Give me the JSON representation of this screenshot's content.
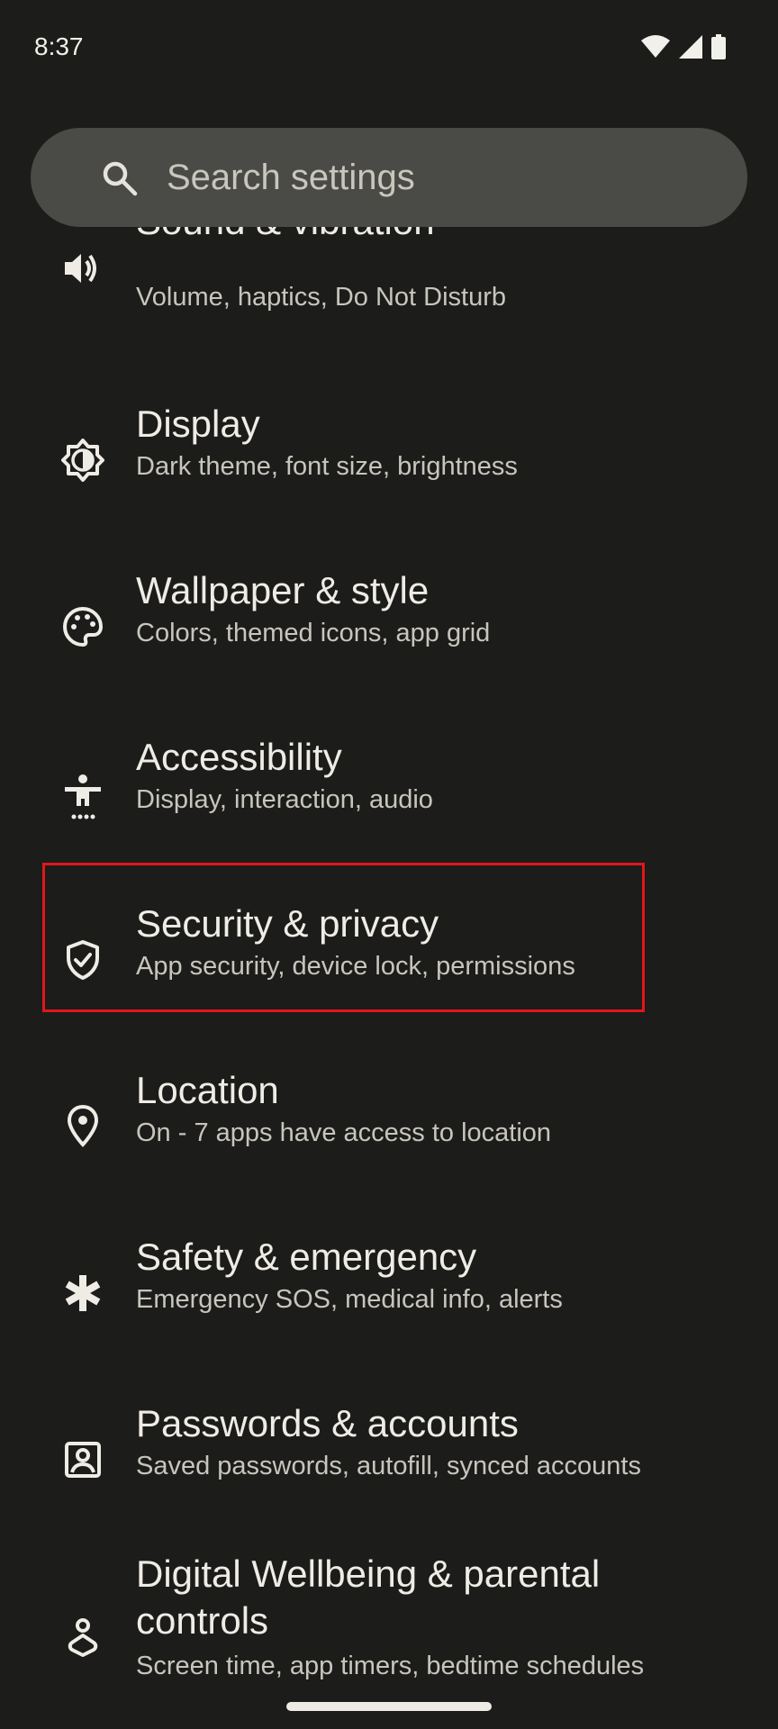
{
  "status_bar": {
    "time": "8:37",
    "icons": [
      "wifi-icon",
      "cell-signal-icon",
      "battery-icon"
    ]
  },
  "search": {
    "placeholder": "Search settings",
    "icon": "search-icon"
  },
  "settings": {
    "items": [
      {
        "title": "Sound & vibration",
        "subtitle": "Volume, haptics, Do Not Disturb",
        "icon": "volume-icon"
      },
      {
        "title": "Display",
        "subtitle": "Dark theme, font size, brightness",
        "icon": "brightness-icon"
      },
      {
        "title": "Wallpaper & style",
        "subtitle": "Colors, themed icons, app grid",
        "icon": "palette-icon"
      },
      {
        "title": "Accessibility",
        "subtitle": "Display, interaction, audio",
        "icon": "accessibility-icon"
      },
      {
        "title": "Security & privacy",
        "subtitle": "App security, device lock, permissions",
        "icon": "shield-icon"
      },
      {
        "title": "Location",
        "subtitle": "On - 7 apps have access to location",
        "icon": "location-pin-icon"
      },
      {
        "title": "Safety & emergency",
        "subtitle": "Emergency SOS, medical info, alerts",
        "icon": "asterisk-icon"
      },
      {
        "title": "Passwords & accounts",
        "subtitle": "Saved passwords, autofill, synced accounts",
        "icon": "account-box-icon"
      },
      {
        "title_line1": "Digital Wellbeing & parental",
        "title_line2": "controls",
        "subtitle": "Screen time, app timers, bedtime schedules",
        "icon": "wellbeing-icon"
      }
    ]
  },
  "colors": {
    "background": "#1c1c1a",
    "search_bar": "#4a4b46",
    "highlight": "#e1161b"
  }
}
